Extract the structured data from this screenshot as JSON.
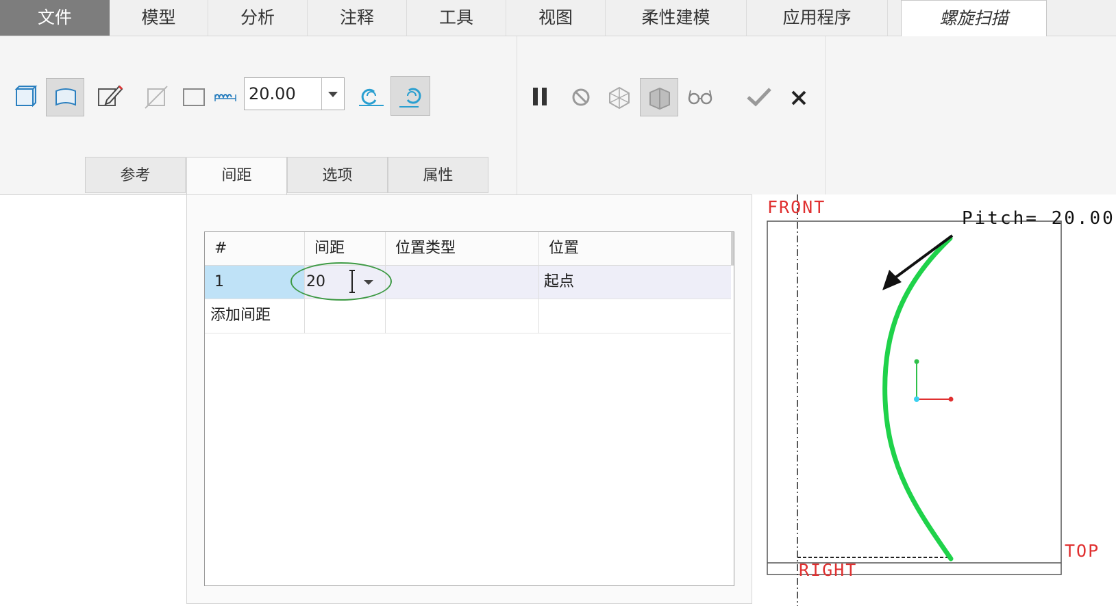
{
  "ribbon_tabs": [
    {
      "label": "文件"
    },
    {
      "label": "模型"
    },
    {
      "label": "分析"
    },
    {
      "label": "注释"
    },
    {
      "label": "工具"
    },
    {
      "label": "视图"
    },
    {
      "label": "柔性建模"
    },
    {
      "label": "应用程序"
    },
    {
      "label": "螺旋扫描"
    }
  ],
  "toolbar": {
    "pitch_value": "20.00"
  },
  "sub_tabs": [
    {
      "label": "参考"
    },
    {
      "label": "间距"
    },
    {
      "label": "选项"
    },
    {
      "label": "属性"
    }
  ],
  "pitch_table": {
    "columns": [
      "#",
      "间距",
      "位置类型",
      "位置"
    ],
    "rows": [
      {
        "num": "1",
        "pitch": "20",
        "location_type": "",
        "location": "起点"
      }
    ],
    "add_label": "添加间距"
  },
  "viewport": {
    "front_label": "FRONT",
    "right_label": "RIGHT",
    "top_label": "TOP",
    "pitch_text": "Pitch= 20.00",
    "profile_color": "#1fd24a",
    "datum_color": "#e03030"
  }
}
